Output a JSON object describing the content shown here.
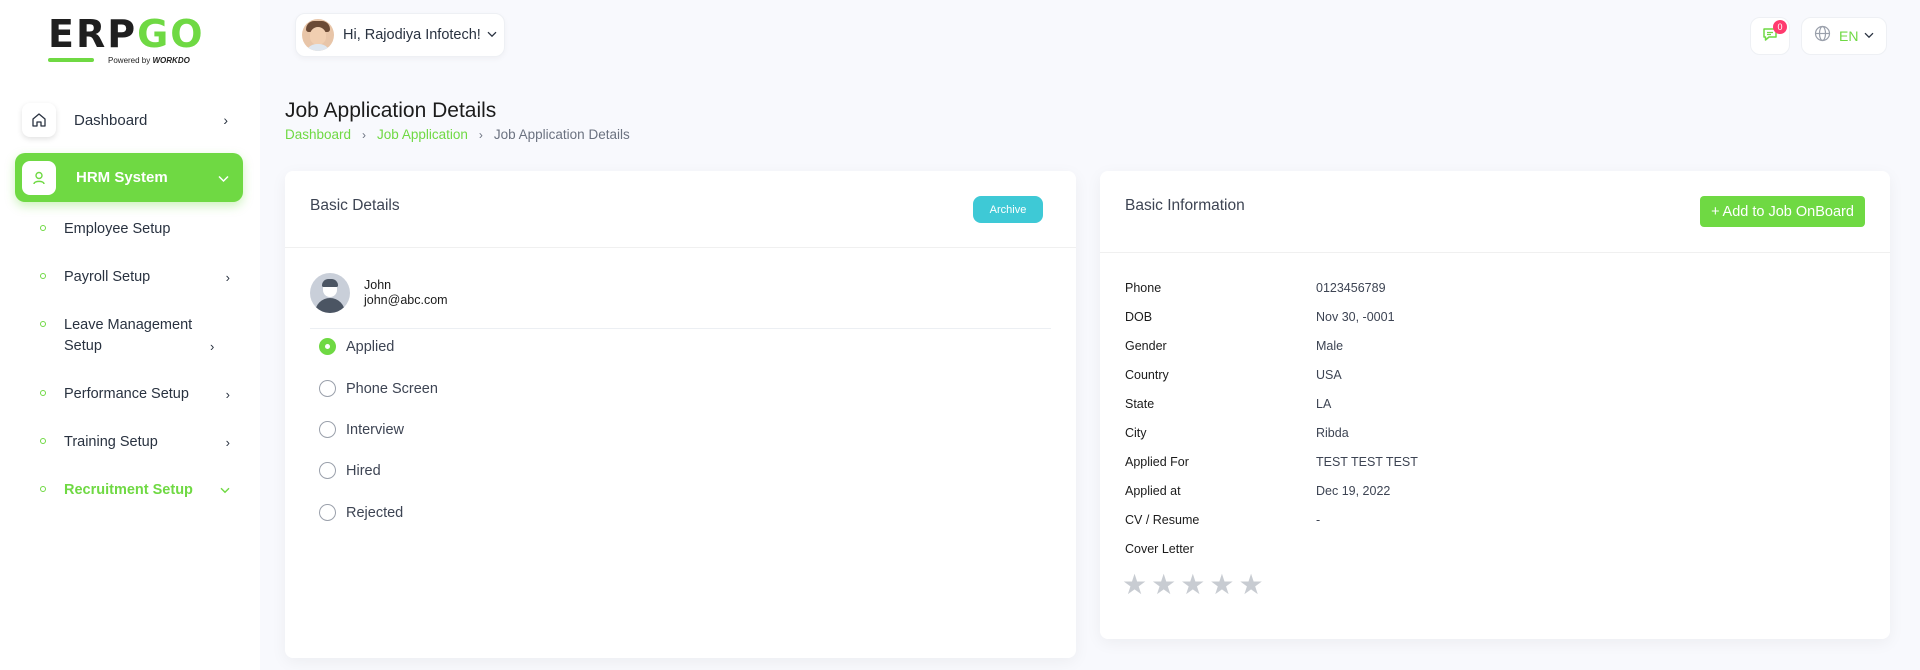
{
  "brand": {
    "logo_text_left": "ERP",
    "logo_text_right": "GO",
    "powered_by": "Powered by",
    "powered_brand": "WORKDO",
    "accent": "#6fd943"
  },
  "sidebar": {
    "main_items": [
      {
        "label": "Dashboard",
        "icon": "home-icon"
      },
      {
        "label": "HRM System",
        "icon": "user-icon"
      }
    ],
    "sub_items": [
      {
        "label": "Employee Setup"
      },
      {
        "label": "Payroll Setup"
      },
      {
        "label": "Leave Management Setup"
      },
      {
        "label": "Performance Setup"
      },
      {
        "label": "Training Setup"
      },
      {
        "label": "Recruitment Setup"
      }
    ]
  },
  "header": {
    "greeting": "Hi, Rajodiya Infotech!",
    "notification_count": "0",
    "language": "EN"
  },
  "page": {
    "title": "Job Application Details",
    "breadcrumb": [
      "Dashboard",
      "Job Application",
      "Job Application Details"
    ]
  },
  "basic_details": {
    "title": "Basic Details",
    "archive_label": "Archive",
    "applicant_name": "John",
    "applicant_email": "john@abc.com",
    "stages": [
      "Applied",
      "Phone Screen",
      "Interview",
      "Hired",
      "Rejected"
    ],
    "selected_stage": "Applied"
  },
  "basic_info": {
    "title": "Basic Information",
    "onboard_label": "Add to Job OnBoard",
    "rows": [
      {
        "key": "Phone",
        "value": "0123456789"
      },
      {
        "key": "DOB",
        "value": "Nov 30, -0001"
      },
      {
        "key": "Gender",
        "value": "Male"
      },
      {
        "key": "Country",
        "value": "USA"
      },
      {
        "key": "State",
        "value": "LA"
      },
      {
        "key": "City",
        "value": "Ribda"
      },
      {
        "key": "Applied For",
        "value": "TEST TEST TEST"
      },
      {
        "key": "Applied at",
        "value": "Dec 19, 2022"
      },
      {
        "key": "CV / Resume",
        "value": "-"
      },
      {
        "key": "Cover Letter",
        "value": ""
      }
    ],
    "rating": 0,
    "rating_max": 5
  }
}
